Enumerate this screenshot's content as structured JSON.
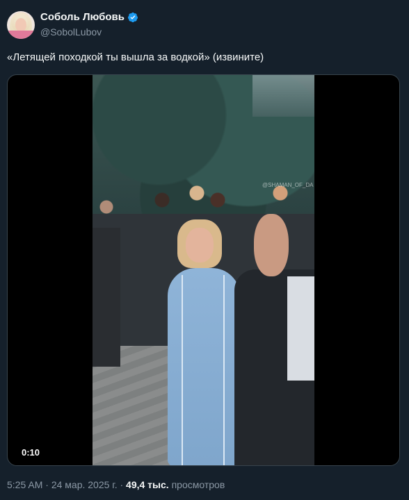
{
  "author": {
    "display_name": "Соболь Любовь",
    "handle": "@SobolLubov",
    "verified": true
  },
  "tweet": {
    "text": "«Летящей походкой ты вышла за водкой» (извините)"
  },
  "media": {
    "video_duration": "0:10",
    "watermark": "@SHAMAN_OF_DA"
  },
  "meta": {
    "time": "5:25 AM",
    "separator": "·",
    "date": "24 мар. 2025 г.",
    "views_count": "49,4 тыс.",
    "views_label": "просмотров"
  },
  "colors": {
    "background": "#15202b",
    "primary_text": "#f7f9f9",
    "secondary_text": "#8b98a5",
    "verified_badge": "#1d9bf0"
  },
  "icons": {
    "verified": "verified-badge-icon",
    "more": "more-icon"
  }
}
